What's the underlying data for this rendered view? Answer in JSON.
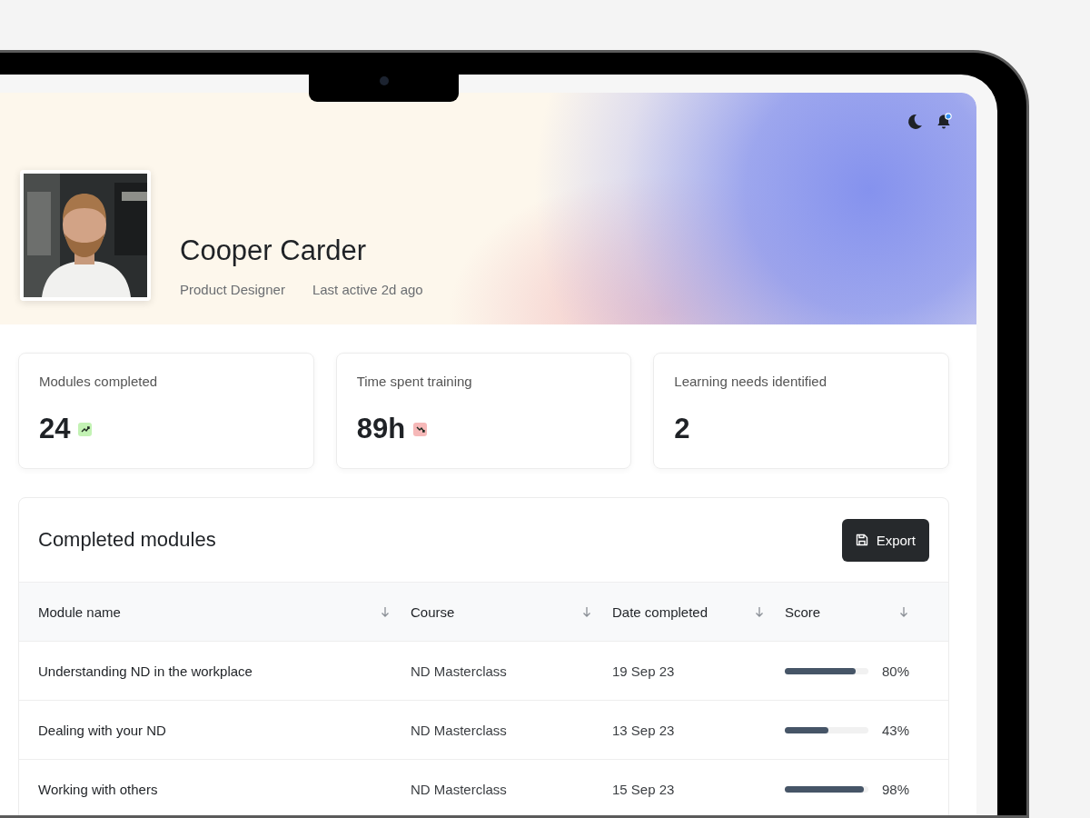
{
  "header": {
    "name": "Cooper Carder",
    "role": "Product Designer",
    "last_active": "Last active 2d ago",
    "notifications_unread": true
  },
  "stats": [
    {
      "label": "Modules completed",
      "value": "24",
      "rising": true
    },
    {
      "label": "Time spent training",
      "value": "89h",
      "rising": false
    },
    {
      "label": "Learning needs identified",
      "value": "2"
    }
  ],
  "table": {
    "title": "Completed modules",
    "export_label": "Export",
    "columns": [
      {
        "label": "Module name"
      },
      {
        "label": "Course"
      },
      {
        "label": "Date completed"
      },
      {
        "label": "Score"
      }
    ],
    "rows": [
      {
        "module": "Understanding ND in the workplace",
        "course": "ND Masterclass",
        "date": "19 Sep 23",
        "score": {
          "level": 0.85,
          "reading": "80%"
        }
      },
      {
        "module": "Dealing with your ND",
        "course": "ND Masterclass",
        "date": "13 Sep 23",
        "score": {
          "level": 0.52,
          "reading": "43%"
        }
      },
      {
        "module": "Working with others",
        "course": "ND Masterclass",
        "date": "15 Sep 23",
        "score": {
          "level": 0.95,
          "reading": "98%"
        }
      }
    ]
  }
}
